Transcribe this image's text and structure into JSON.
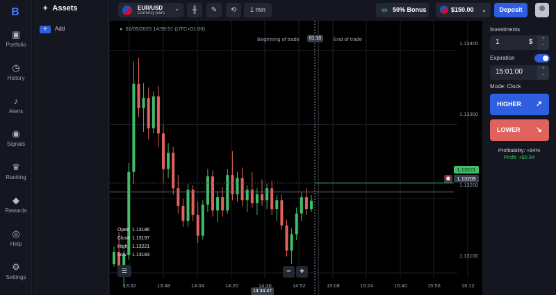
{
  "nav": {
    "items": [
      {
        "label": "Portfolio",
        "icon": "briefcase-icon"
      },
      {
        "label": "History",
        "icon": "history-icon"
      },
      {
        "label": "Alerts",
        "icon": "bell-icon"
      },
      {
        "label": "Signals",
        "icon": "signal-icon"
      },
      {
        "label": "Ranking",
        "icon": "trophy-icon"
      },
      {
        "label": "Rewards",
        "icon": "diamond-icon"
      },
      {
        "label": "Help",
        "icon": "lifebuoy-icon"
      },
      {
        "label": "Settings",
        "icon": "gear-icon"
      }
    ]
  },
  "assets": {
    "title": "Assets",
    "add_label": "Add"
  },
  "topbar": {
    "pair": "EUR/USD",
    "pair_sub": "Currency pairs",
    "timeframe": "1 min",
    "bonus": "50% Bonus",
    "balance": "$150.00",
    "deposit": "Deposit"
  },
  "chart": {
    "datetime": "01/05/2025  14:59:51  (UTC+01:00)",
    "beginning_label": "Beginning of trade",
    "end_label": "End of trade",
    "timer": "01:10",
    "ohlc": [
      {
        "k": "Open",
        "v": "1.13186"
      },
      {
        "k": "Close",
        "v": "1.13197"
      },
      {
        "k": "High",
        "v": "1.13221"
      },
      {
        "k": "Low",
        "v": "1.13183"
      }
    ],
    "current_price": "1.13221",
    "open_price": "1.13209",
    "current_time": "14:34:47",
    "zoom_out": "−",
    "zoom_in": "+"
  },
  "chart_data": {
    "type": "candlestick",
    "xlabel": "",
    "ylabel": "",
    "x_ticks": [
      "13:32",
      "13:48",
      "14:04",
      "14:20",
      "14:36",
      "14:52",
      "15:08",
      "15:24",
      "15:40",
      "15:56",
      "16:12"
    ],
    "y_ticks": [
      "1.13400",
      "1.13300",
      "1.13200",
      "1.13100"
    ],
    "ylim": [
      1.1307,
      1.1344
    ],
    "price_line": 1.13221,
    "open_line": 1.13209,
    "series": [
      {
        "values": [
          [
            1.13112,
            1.13135,
            1.13108,
            1.13128
          ],
          [
            1.13128,
            1.13155,
            1.13095,
            1.13102
          ],
          [
            1.13102,
            1.1313,
            1.1308,
            1.13124
          ],
          [
            1.13124,
            1.13248,
            1.13118,
            1.13236
          ],
          [
            1.13236,
            1.13385,
            1.1322,
            1.13355
          ],
          [
            1.13355,
            1.1339,
            1.1331,
            1.13322
          ],
          [
            1.13322,
            1.13356,
            1.1329,
            1.13336
          ],
          [
            1.13336,
            1.1335,
            1.1328,
            1.13295
          ],
          [
            1.13295,
            1.13345,
            1.13288,
            1.13338
          ],
          [
            1.13338,
            1.13352,
            1.1327,
            1.13288
          ],
          [
            1.13288,
            1.133,
            1.1322,
            1.1324
          ],
          [
            1.1324,
            1.13275,
            1.13228,
            1.13262
          ],
          [
            1.13262,
            1.1327,
            1.13205,
            1.13214
          ],
          [
            1.13214,
            1.13232,
            1.1318,
            1.1319
          ],
          [
            1.1319,
            1.132,
            1.13162,
            1.1317
          ],
          [
            1.1317,
            1.1322,
            1.13162,
            1.13212
          ],
          [
            1.13212,
            1.13218,
            1.1317,
            1.13178
          ],
          [
            1.13178,
            1.13196,
            1.1314,
            1.1315
          ],
          [
            1.1315,
            1.13198,
            1.13145,
            1.13192
          ],
          [
            1.13192,
            1.1324,
            1.13182,
            1.1323
          ],
          [
            1.1323,
            1.13238,
            1.13176,
            1.13184
          ],
          [
            1.13184,
            1.1321,
            1.13168,
            1.13202
          ],
          [
            1.13202,
            1.13216,
            1.13176,
            1.13184
          ],
          [
            1.13184,
            1.1324,
            1.1318,
            1.13232
          ],
          [
            1.13232,
            1.13264,
            1.13198,
            1.13206
          ],
          [
            1.13206,
            1.13236,
            1.13196,
            1.13228
          ],
          [
            1.13228,
            1.13242,
            1.1319,
            1.13198
          ],
          [
            1.13198,
            1.13218,
            1.13182,
            1.13212
          ],
          [
            1.13212,
            1.13236,
            1.13188,
            1.13194
          ],
          [
            1.13194,
            1.13214,
            1.13178,
            1.13206
          ],
          [
            1.13206,
            1.13226,
            1.1319,
            1.13198
          ],
          [
            1.13198,
            1.1322,
            1.13186,
            1.13214
          ],
          [
            1.13214,
            1.13224,
            1.13178,
            1.13186
          ],
          [
            1.13186,
            1.13205,
            1.1317,
            1.13198
          ],
          [
            1.13198,
            1.13206,
            1.13158,
            1.13164
          ],
          [
            1.13164,
            1.13172,
            1.13122,
            1.1313
          ],
          [
            1.1313,
            1.1316,
            1.13112,
            1.13152
          ],
          [
            1.13152,
            1.13188,
            1.13144,
            1.1318
          ],
          [
            1.1318,
            1.1321,
            1.1317,
            1.13202
          ],
          [
            1.13202,
            1.13214,
            1.13178,
            1.13186
          ],
          [
            1.13186,
            1.13205,
            1.13182,
            1.13197
          ]
        ]
      }
    ]
  },
  "panel": {
    "investments_label": "Investments",
    "investment_value": "1",
    "currency": "$",
    "expiration_label": "Expiration",
    "expiration_value": "15:01:00",
    "mode": "Mode: Clock",
    "higher": "HIGHER",
    "lower": "LOWER",
    "profitability": "Profitability: +84%",
    "profit": "Profit: +$0.84",
    "plus": "+",
    "minus": "−"
  },
  "colors": {
    "up": "#3fbf6a",
    "down": "#e0625c",
    "accent": "#2f5fe0"
  }
}
